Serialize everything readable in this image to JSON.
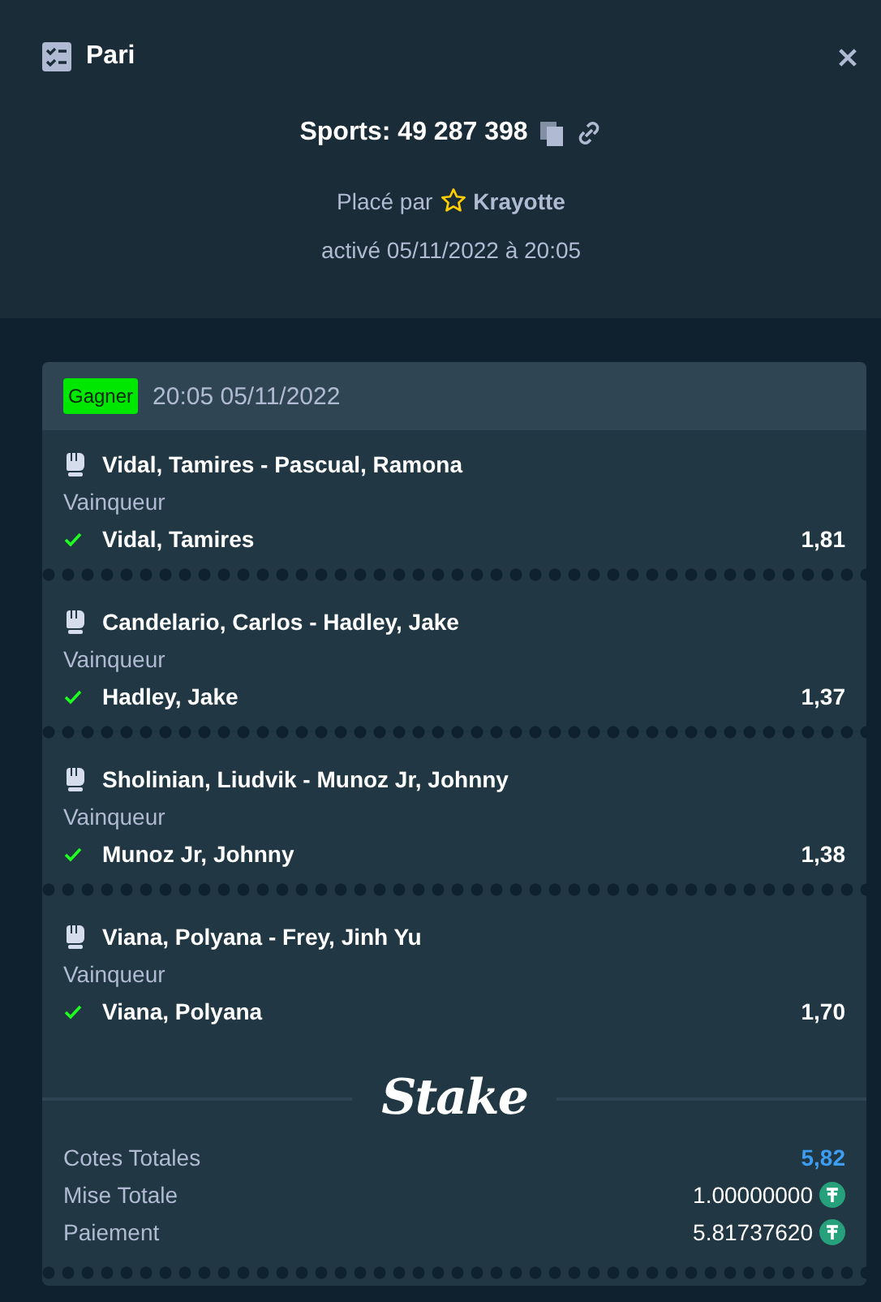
{
  "header": {
    "title": "Pari",
    "bet_id": "Sports: 49 287 398",
    "placed_by_label": "Placé par",
    "user": "Krayotte",
    "activated": "activé 05/11/2022 à 20:05"
  },
  "bet": {
    "status": {
      "label": "Gagner",
      "kind": "won"
    },
    "datetime": "20:05 05/11/2022",
    "legs": [
      {
        "event": "Vidal, Tamires - Pascual, Ramona",
        "market": "Vainqueur",
        "selection": "Vidal, Tamires",
        "odds": "1,81",
        "won": true
      },
      {
        "event": "Candelario, Carlos - Hadley, Jake",
        "market": "Vainqueur",
        "selection": "Hadley, Jake",
        "odds": "1,37",
        "won": true
      },
      {
        "event": "Sholinian, Liudvik - Munoz Jr, Johnny",
        "market": "Vainqueur",
        "selection": "Munoz Jr, Johnny",
        "odds": "1,38",
        "won": true
      },
      {
        "event": "Viana, Polyana - Frey, Jinh Yu",
        "market": "Vainqueur",
        "selection": "Viana, Polyana",
        "odds": "1,70",
        "won": true
      }
    ],
    "logo": "Stake",
    "summary": [
      {
        "label": "Cotes Totales",
        "value": "5,82",
        "kind": "odds"
      },
      {
        "label": "Mise Totale",
        "value": "1.00000000",
        "kind": "amount"
      },
      {
        "label": "Paiement",
        "value": "5.81737620",
        "kind": "amount"
      }
    ]
  }
}
